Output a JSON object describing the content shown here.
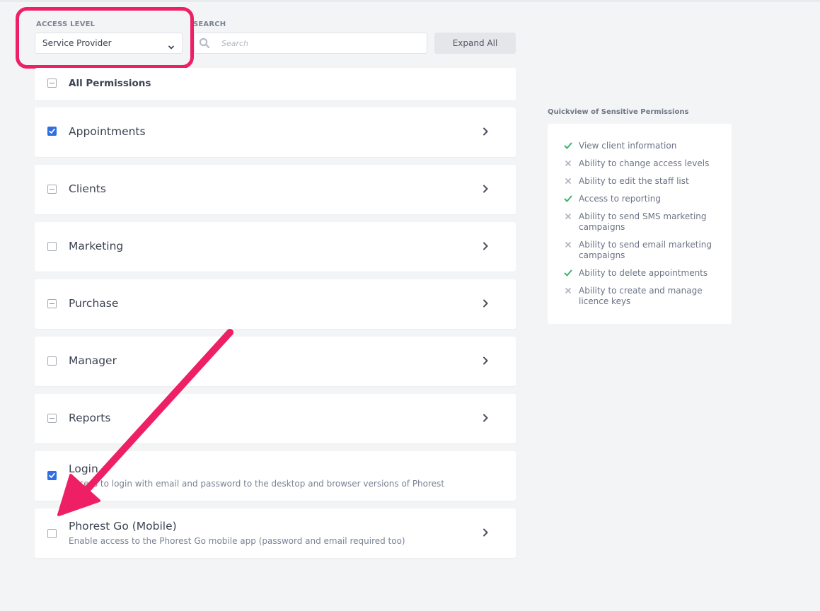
{
  "filters": {
    "access_level_label": "ACCESS LEVEL",
    "access_level_value": "Service Provider",
    "search_label": "SEARCH",
    "search_placeholder": "Search",
    "expand_all_label": "Expand All"
  },
  "permissions": {
    "all": {
      "label": "All Permissions",
      "state": "indeterminate"
    },
    "items": [
      {
        "label": "Appointments",
        "state": "checked"
      },
      {
        "label": "Clients",
        "state": "indeterminate"
      },
      {
        "label": "Marketing",
        "state": "unchecked"
      },
      {
        "label": "Purchase",
        "state": "indeterminate"
      },
      {
        "label": "Manager",
        "state": "unchecked"
      },
      {
        "label": "Reports",
        "state": "indeterminate"
      },
      {
        "label": "Login",
        "description": "Access to login with email and password to the desktop and browser versions of Phorest",
        "state": "checked"
      },
      {
        "label": "Phorest Go (Mobile)",
        "description": "Enable access to the Phorest Go mobile app (password and email required too)",
        "state": "unchecked"
      }
    ]
  },
  "quickview": {
    "title": "Quickview of Sensitive Permissions",
    "items": [
      {
        "label": "View client information",
        "allowed": true
      },
      {
        "label": "Ability to change access levels",
        "allowed": false
      },
      {
        "label": "Ability to edit the staff list",
        "allowed": false
      },
      {
        "label": "Access to reporting",
        "allowed": true
      },
      {
        "label": "Ability to send SMS marketing campaigns",
        "allowed": false
      },
      {
        "label": "Ability to send email marketing campaigns",
        "allowed": false
      },
      {
        "label": "Ability to delete appointments",
        "allowed": true
      },
      {
        "label": "Ability to create and manage licence keys",
        "allowed": false
      }
    ]
  },
  "colors": {
    "accent": "#2f6fe4",
    "highlight": "#ee1f64",
    "allowed": "#3cb371",
    "denied": "#b0b6c2"
  }
}
